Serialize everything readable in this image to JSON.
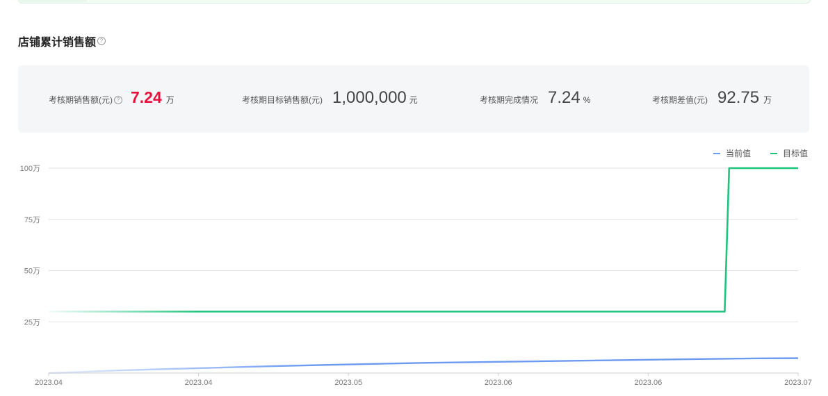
{
  "section": {
    "title": "店铺累计销售额",
    "help_icon": "?"
  },
  "stats": [
    {
      "label": "考核期销售额(元)",
      "has_help": true,
      "value": "7.24",
      "unit": "万",
      "highlight": true
    },
    {
      "label": "考核期目标销售额(元)",
      "has_help": false,
      "value": "1,000,000",
      "unit": "元",
      "highlight": false
    },
    {
      "label": "考核期完成情况",
      "has_help": false,
      "value": "7.24",
      "unit": "%",
      "highlight": false
    },
    {
      "label": "考核期差值(元)",
      "has_help": false,
      "value": "92.75",
      "unit": "万",
      "highlight": false
    }
  ],
  "chart_data": {
    "type": "line",
    "x_tick_labels": [
      "2023.04",
      "2023.04",
      "2023.05",
      "2023.06",
      "2023.06",
      "2023.07"
    ],
    "y_tick_labels": [
      "25万",
      "50万",
      "75万",
      "100万"
    ],
    "ylim": [
      0,
      100
    ],
    "y_unit": "万",
    "grid": true,
    "legend_position": "top-right",
    "series": [
      {
        "name": "当前值",
        "color": "#6b9af0",
        "x": [
          0,
          0.1,
          0.2,
          0.3,
          0.4,
          0.5,
          0.6,
          0.7,
          0.8,
          0.9,
          0.95,
          1.0
        ],
        "values": [
          0,
          1.4,
          2.4,
          3.4,
          4.2,
          5.0,
          5.5,
          6.0,
          6.5,
          7.0,
          7.2,
          7.24
        ]
      },
      {
        "name": "目标值",
        "color": "#1ec47e",
        "x": [
          0,
          0.902,
          0.908,
          1.0
        ],
        "values": [
          30,
          30,
          100,
          100
        ]
      }
    ]
  }
}
